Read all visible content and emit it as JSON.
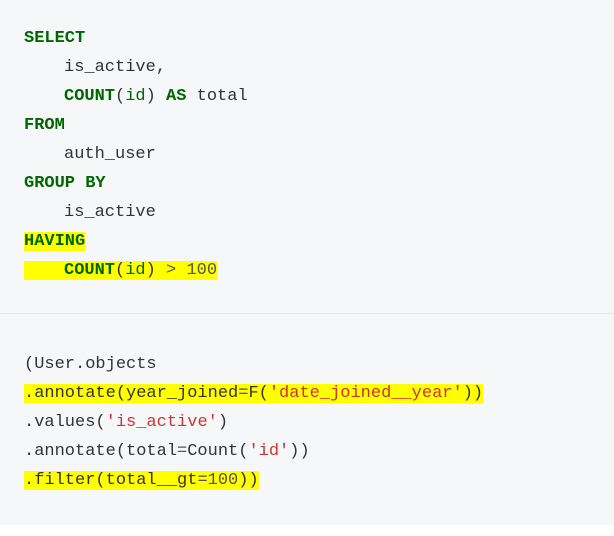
{
  "sql": {
    "select": "SELECT",
    "is_active": "is_active,",
    "count_open": "COUNT",
    "lparen1": "(",
    "id1": "id",
    "rparen1": ")",
    "as": "AS",
    "total": "total",
    "from": "FROM",
    "auth_user": "auth_user",
    "group_by": "GROUP BY",
    "is_active2": "is_active",
    "having": "HAVING",
    "count2": "COUNT",
    "lparen2": "(",
    "id2": "id",
    "rparen2": ")",
    "gt": ">",
    "hundred": "100"
  },
  "py": {
    "user_objects": "(User.objects",
    "dot_annotate1": ".annotate(year_joined",
    "eq1": "=",
    "f_func": "F(",
    "date_joined_year": "'date_joined__year'",
    "close1": "))",
    "dot_values": ".values(",
    "is_active_str": "'is_active'",
    "close2": ")",
    "dot_annotate2": ".annotate(total",
    "eq2": "=",
    "count_func": "Count(",
    "id_str": "'id'",
    "close3": "))",
    "dot_filter": ".filter(total__gt",
    "eq3": "=",
    "hundred2": "100",
    "close4": "))"
  },
  "chart_data": {
    "type": "table",
    "title": "SQL with HAVING clause vs Django ORM equivalent (highlighted parts show HAVING and filter additions)",
    "sql_query": "SELECT is_active, COUNT(id) AS total FROM auth_user GROUP BY is_active HAVING COUNT(id) > 100",
    "sql_highlighted": [
      "HAVING",
      "COUNT(id) > 100"
    ],
    "django_orm": "(User.objects.annotate(year_joined=F('date_joined__year')).values('is_active').annotate(total=Count('id')).filter(total__gt=100))",
    "django_highlighted": [
      ".annotate(year_joined=F('date_joined__year'))",
      ".filter(total__gt=100))"
    ]
  }
}
